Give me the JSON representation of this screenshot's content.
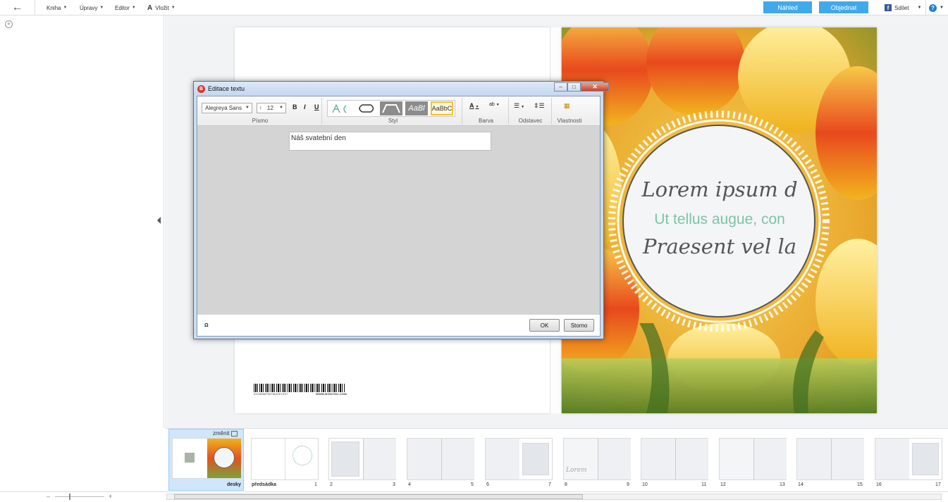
{
  "menubar": {
    "back_icon": "arrow-left-icon",
    "items": [
      "Kniha",
      "Úpravy",
      "Editor",
      "Vložit"
    ],
    "preview_label": "Náhled",
    "order_label": "Objednat",
    "share_label": "Sdílet",
    "help_label": "?"
  },
  "book": {
    "barcode_number": "0128066TBCMU001337",
    "barcode_site": "WWW.BONYSU.COM",
    "cover_line1": "Lorem ipsum d",
    "cover_line2": "Ut tellus augue, con",
    "cover_line3": "Praesent vel la"
  },
  "dialog": {
    "title": "Editace textu",
    "font_family": "Alegreya Sans",
    "font_size": "12",
    "bold": "B",
    "italic": "I",
    "underline": "U",
    "group_font": "Písmo",
    "group_style": "Styl",
    "group_color": "Barva",
    "group_paragraph": "Odstavec",
    "group_properties": "Vlastnosti",
    "style_sample": "AaBbC",
    "style_sample2": "AaBl",
    "text_value": "Náš svatební den",
    "ok_label": "OK",
    "cancel_label": "Storno"
  },
  "thumbs": {
    "change_label": "změnit",
    "cover_label": "desky",
    "endpaper_label": "předsádka",
    "lorem_label": "Lorem",
    "page_numbers": [
      "1",
      "2",
      "3",
      "4",
      "5",
      "6",
      "7",
      "8",
      "9",
      "10",
      "11",
      "12",
      "13",
      "14",
      "15",
      "16",
      "17"
    ]
  },
  "colors": {
    "accent": "#3fa9ec",
    "cover_teal": "#7cc4a8"
  }
}
